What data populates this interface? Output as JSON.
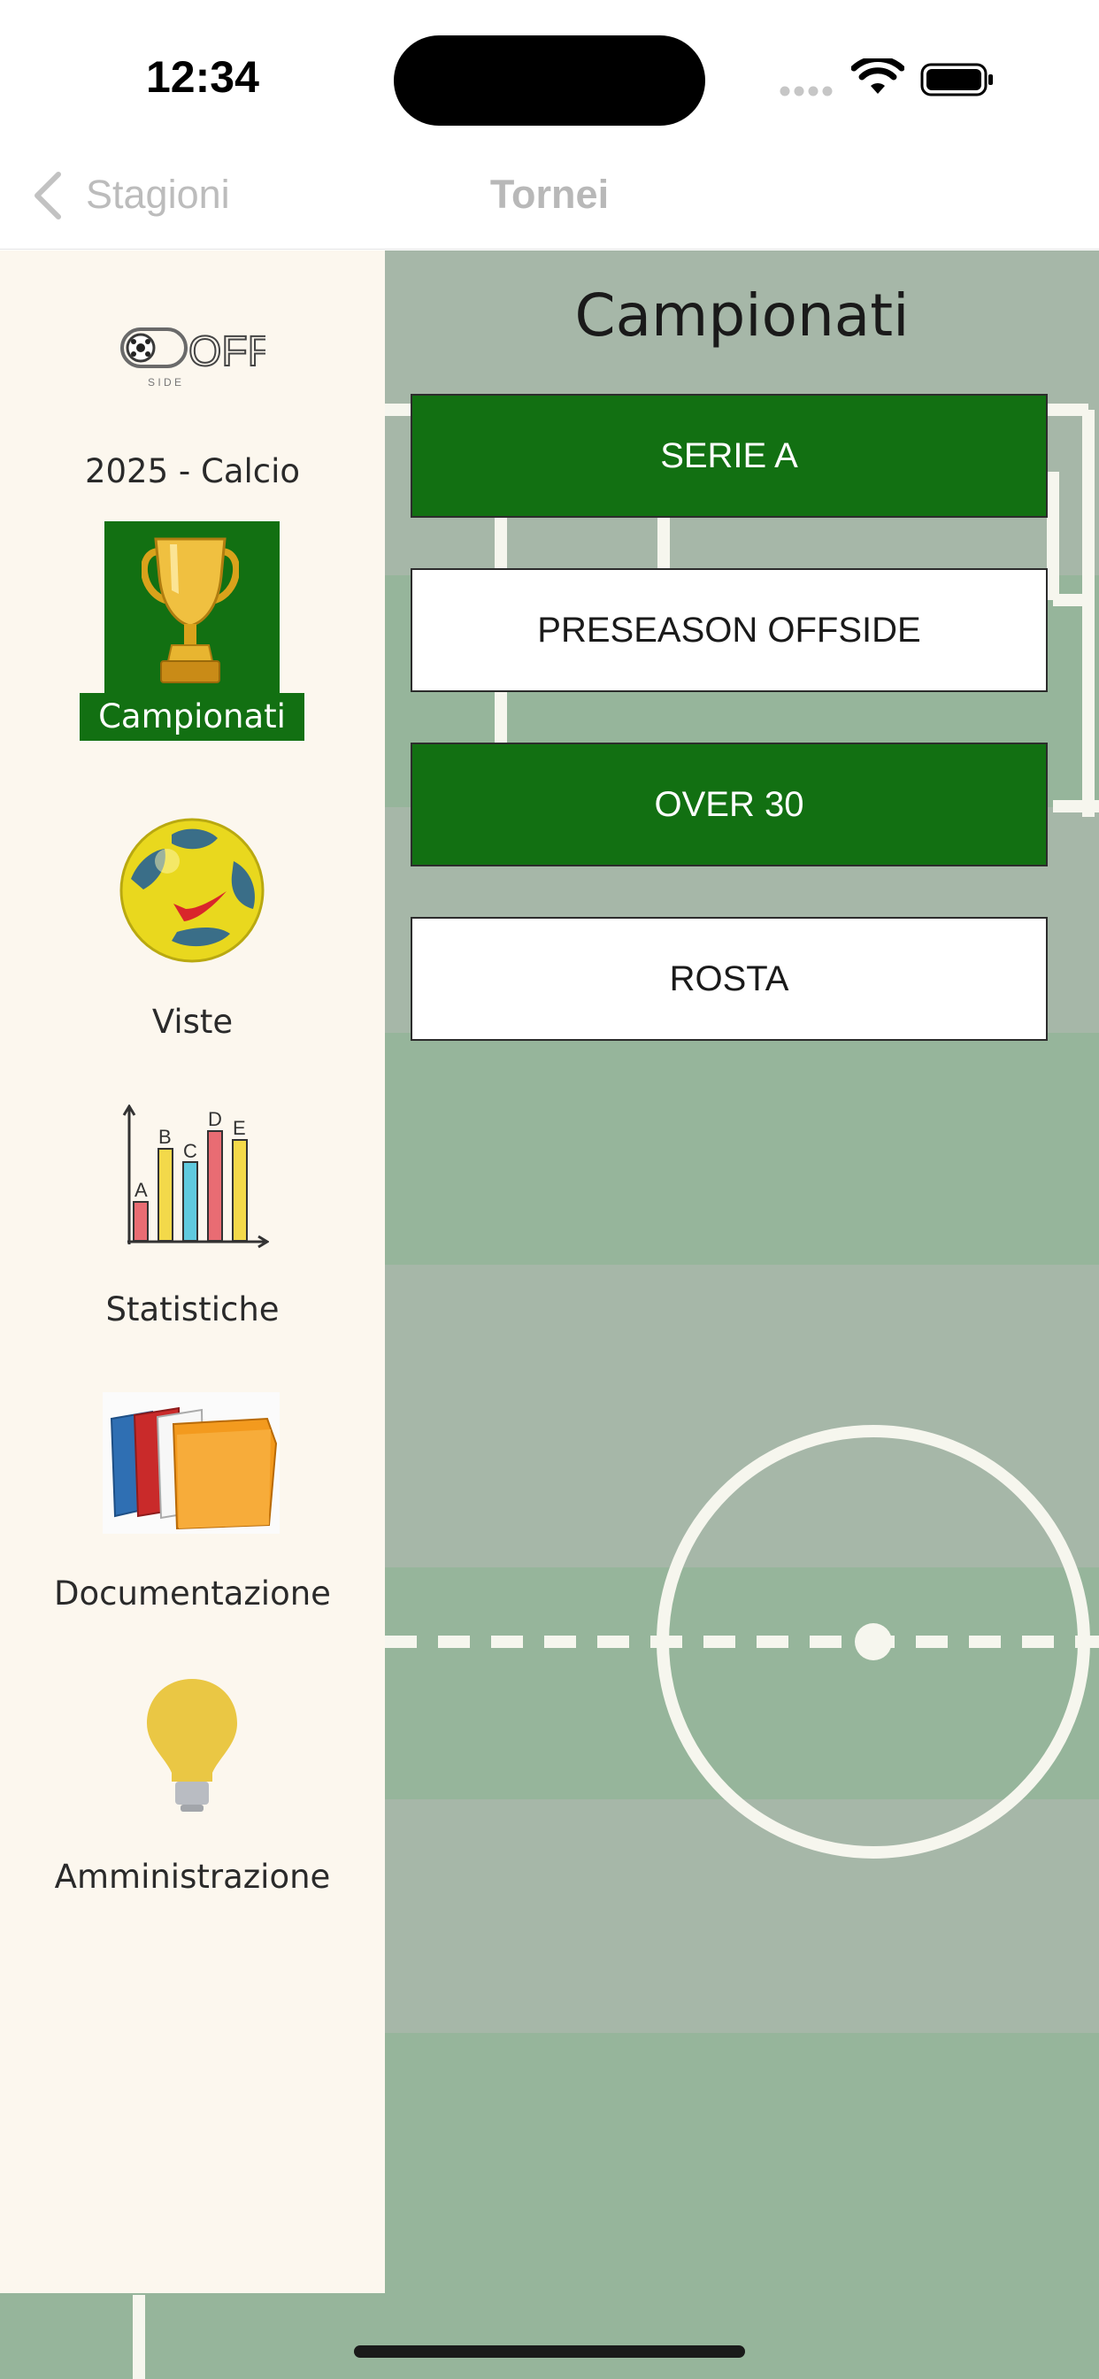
{
  "status_bar": {
    "time": "12:34"
  },
  "nav": {
    "back_label": "Stagioni",
    "title": "Tornei"
  },
  "sidebar": {
    "logo_text": "OFF",
    "logo_subtext": "S I D E",
    "season": "2025 - Calcio",
    "items": [
      {
        "label": "Campionati",
        "icon": "trophy-icon",
        "active": true
      },
      {
        "label": "Viste",
        "icon": "soccer-ball-icon",
        "active": false
      },
      {
        "label": "Statistiche",
        "icon": "bar-chart-icon",
        "active": false
      },
      {
        "label": "Documentazione",
        "icon": "folders-icon",
        "active": false
      },
      {
        "label": "Amministrazione",
        "icon": "lightbulb-icon",
        "active": false
      }
    ],
    "chart_icon_letters": [
      "A",
      "B",
      "C",
      "D",
      "E"
    ]
  },
  "content": {
    "title": "Campionati",
    "championships": [
      {
        "label": "SERIE A",
        "style": "green"
      },
      {
        "label": "PRESEASON OFFSIDE",
        "style": "white"
      },
      {
        "label": "OVER 30",
        "style": "green"
      },
      {
        "label": "ROSTA",
        "style": "white"
      }
    ]
  },
  "colors": {
    "accent_green": "#127012",
    "sidebar_bg": "#fcf7ee",
    "field_stripe_light": "#a6b7a8",
    "field_stripe_dark": "#96b59b",
    "field_line": "#f6f6ee"
  }
}
